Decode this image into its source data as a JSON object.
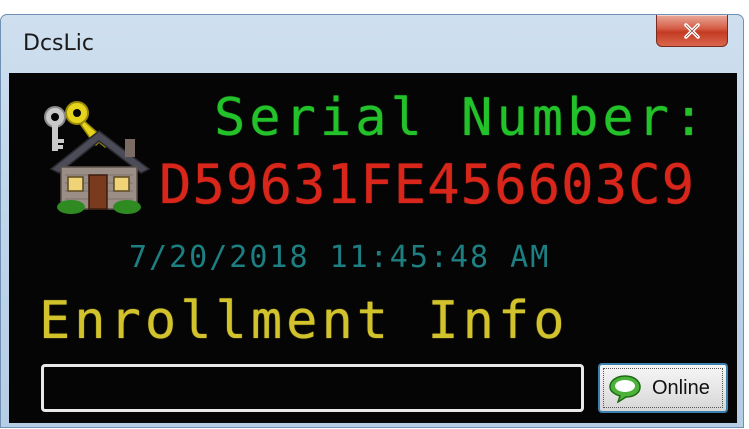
{
  "window": {
    "title": "DcsLic"
  },
  "display": {
    "serial_label": "Serial Number:",
    "serial_value": "D59631FE456603C9",
    "timestamp": "7/20/2018 11:45:48 AM",
    "enrollment_label": "Enrollment Info"
  },
  "enrollment": {
    "value": "",
    "placeholder": ""
  },
  "buttons": {
    "online_label": "Online"
  },
  "icons": {
    "close": "close-icon",
    "app": "house-keys-icon",
    "online": "chat-bubble-icon"
  },
  "colors": {
    "serial_label": "#23c22a",
    "serial_value": "#d8261b",
    "timestamp": "#1d7f82",
    "enrollment_label": "#d2c32c",
    "background": "#050505",
    "close_button": "#c43b23"
  }
}
